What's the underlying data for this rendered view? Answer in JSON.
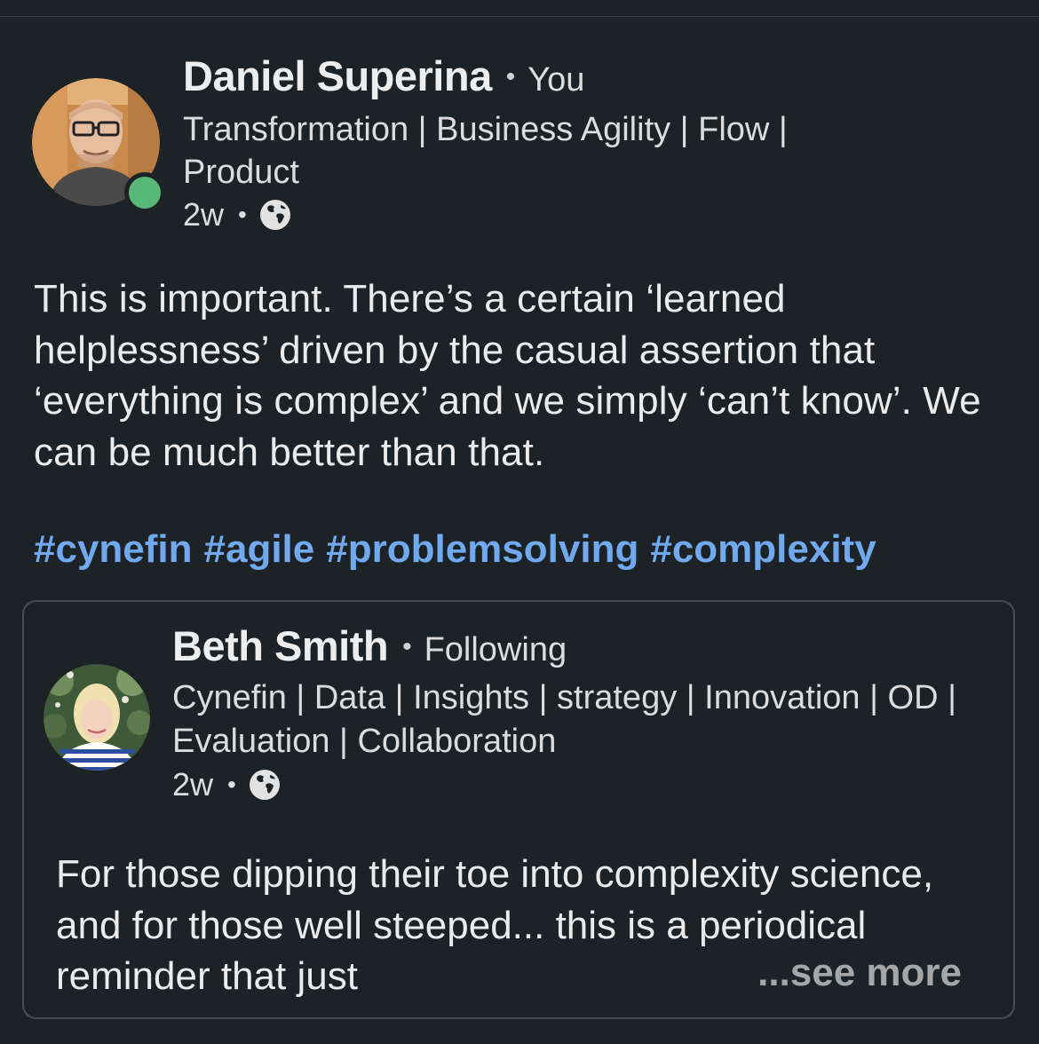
{
  "post": {
    "author": {
      "name": "Daniel Superina",
      "relationship": "You",
      "headline": "Transformation | Business Agility | Flow | Product",
      "time": "2w",
      "visibility_icon": "globe-icon",
      "online_status_color": "#57b877"
    },
    "commentary": "This is important. There’s a certain ‘learned helplessness’ driven by the casual assertion that ‘everything is complex’ and we simply ‘can’t know’. We can be much better than that.",
    "hashtags": [
      "#cynefin",
      "#agile",
      "#problemsolving",
      "#complexity"
    ],
    "hashtag_color": "#70a9ee"
  },
  "shared_post": {
    "author": {
      "name": "Beth Smith",
      "relationship": "Following",
      "headline": "Cynefin | Data | Insights | strategy | Innovation | OD | Evaluation | Collaboration",
      "time": "2w",
      "visibility_icon": "globe-icon"
    },
    "body": "For those dipping their toe into complexity science, and for those well steeped... this is a periodical reminder that just",
    "see_more_label": "...see more"
  },
  "separator": "•",
  "colors": {
    "background": "#1d2226",
    "card_border": "#474d53"
  }
}
